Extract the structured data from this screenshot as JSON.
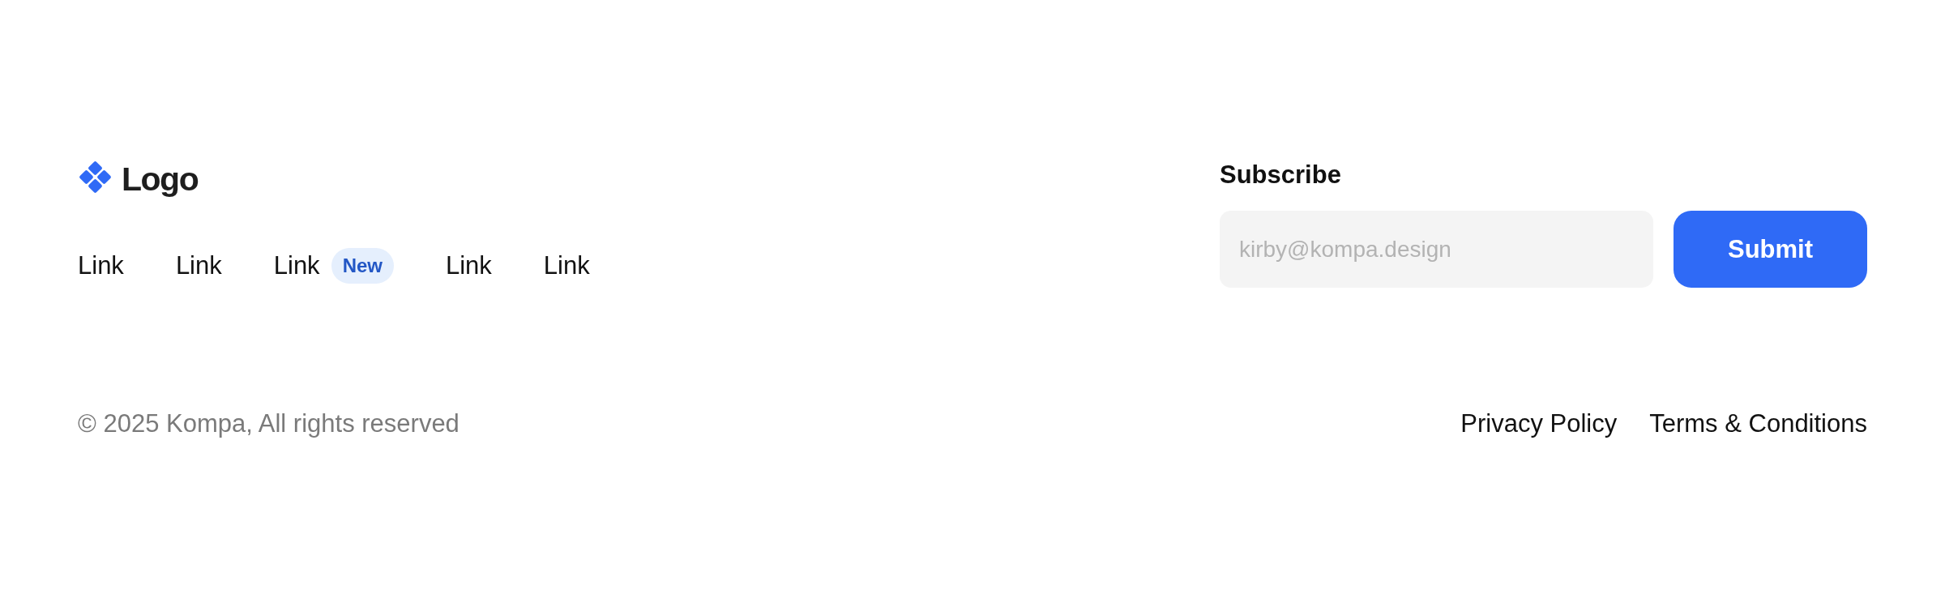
{
  "logo": {
    "text": "Logo"
  },
  "links": [
    {
      "label": "Link"
    },
    {
      "label": "Link"
    },
    {
      "label": "Link",
      "badge": "New"
    },
    {
      "label": "Link"
    },
    {
      "label": "Link"
    }
  ],
  "subscribe": {
    "title": "Subscribe",
    "placeholder": "kirby@kompa.design",
    "button": "Submit"
  },
  "copyright": "© 2025 Kompa, All rights reserved",
  "legal_links": [
    "Privacy Policy",
    "Terms & Conditions"
  ]
}
